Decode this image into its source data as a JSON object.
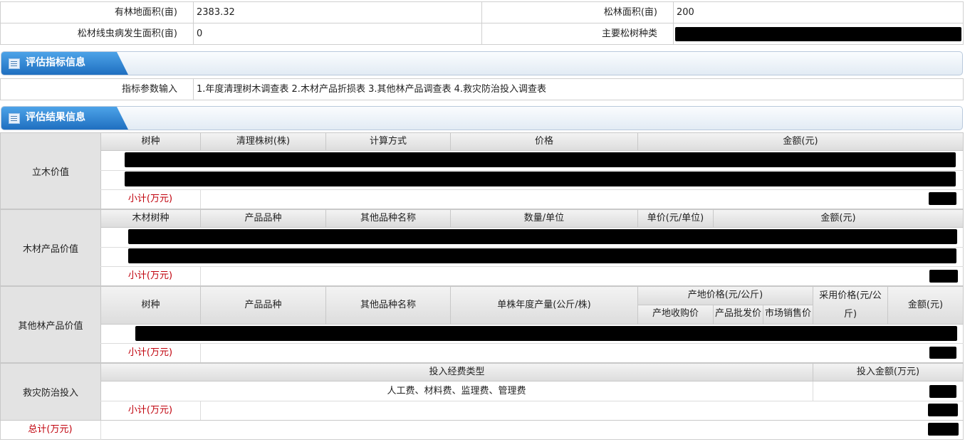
{
  "basic": {
    "forest_area_label": "有林地面积(亩)",
    "forest_area_value": "2383.32",
    "pine_area_label": "松林面积(亩)",
    "pine_area_value": "200",
    "disease_area_label": "松材线虫病发生面积(亩)",
    "disease_area_value": "0",
    "pine_species_label": "主要松树种类"
  },
  "section_indicator": {
    "title": "评估指标信息",
    "param_label": "指标参数输入",
    "param_value": "1.年度清理树木调查表 2.木材产品折损表 3.其他林产品调查表 4.救灾防治投入调查表"
  },
  "section_result": {
    "title": "评估结果信息",
    "standing": {
      "label": "立木价值",
      "columns": [
        "树种",
        "清理株树(株)",
        "计算方式",
        "价格",
        "金额(元)"
      ],
      "subtotal": "小计(万元)"
    },
    "timber": {
      "label": "木材产品价值",
      "columns": [
        "木材树种",
        "产品品种",
        "其他品种名称",
        "数量/单位",
        "单价(元/单位)",
        "金额(元)"
      ],
      "subtotal": "小计(万元)"
    },
    "other": {
      "label": "其他林产品价值",
      "columns": [
        "树种",
        "产品品种",
        "其他品种名称",
        "单株年度产量(公斤/株)",
        "产地价格(元/公斤)",
        "采用价格(元/公斤)",
        "金额(元)"
      ],
      "sub_columns": [
        "产地收购价",
        "产品批发价",
        "市场销售价"
      ],
      "subtotal": "小计(万元)"
    },
    "relief": {
      "label": "救灾防治投入",
      "col_type": "投入经费类型",
      "col_amount": "投入金额(万元)",
      "type_value": "人工费、材料费、监理费、管理费",
      "subtotal": "小计(万元)"
    },
    "total": "总计(万元)"
  }
}
